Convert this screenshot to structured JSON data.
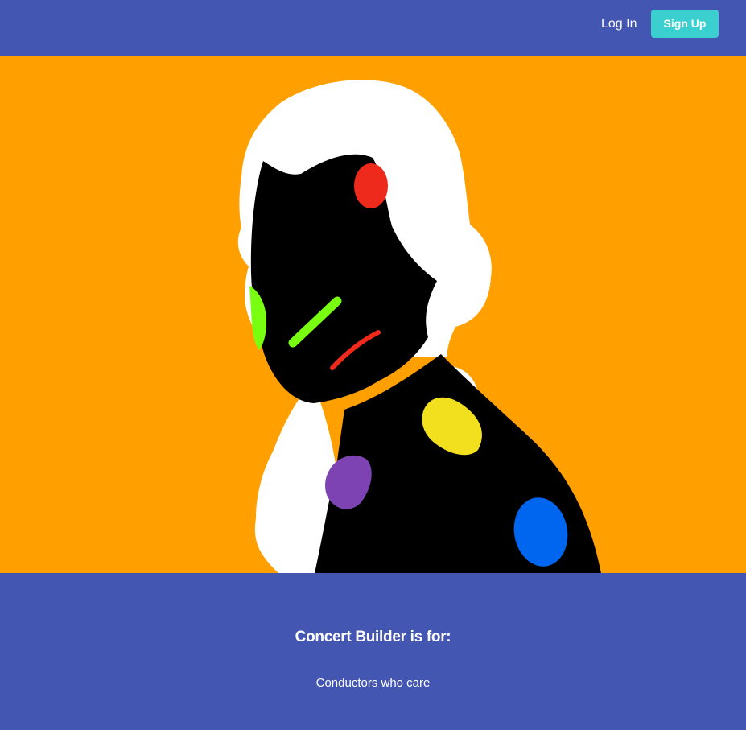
{
  "nav": {
    "login_label": "Log In",
    "signup_label": "Sign Up"
  },
  "hero": {
    "image": "composer-silhouette-illustration",
    "colors": {
      "background": "#ffa000",
      "wig": "#ffffff",
      "figure": "#000000",
      "red": "#ee2a1c",
      "lime": "#79ff10",
      "yellow": "#f2e01f",
      "purple": "#7d43b3",
      "blue": "#0066ef"
    }
  },
  "audience": {
    "title": "Concert Builder is for:",
    "items": [
      "Conductors who care"
    ]
  },
  "colors": {
    "nav_background": "#4356b1",
    "accent": "#3ccfd0"
  }
}
